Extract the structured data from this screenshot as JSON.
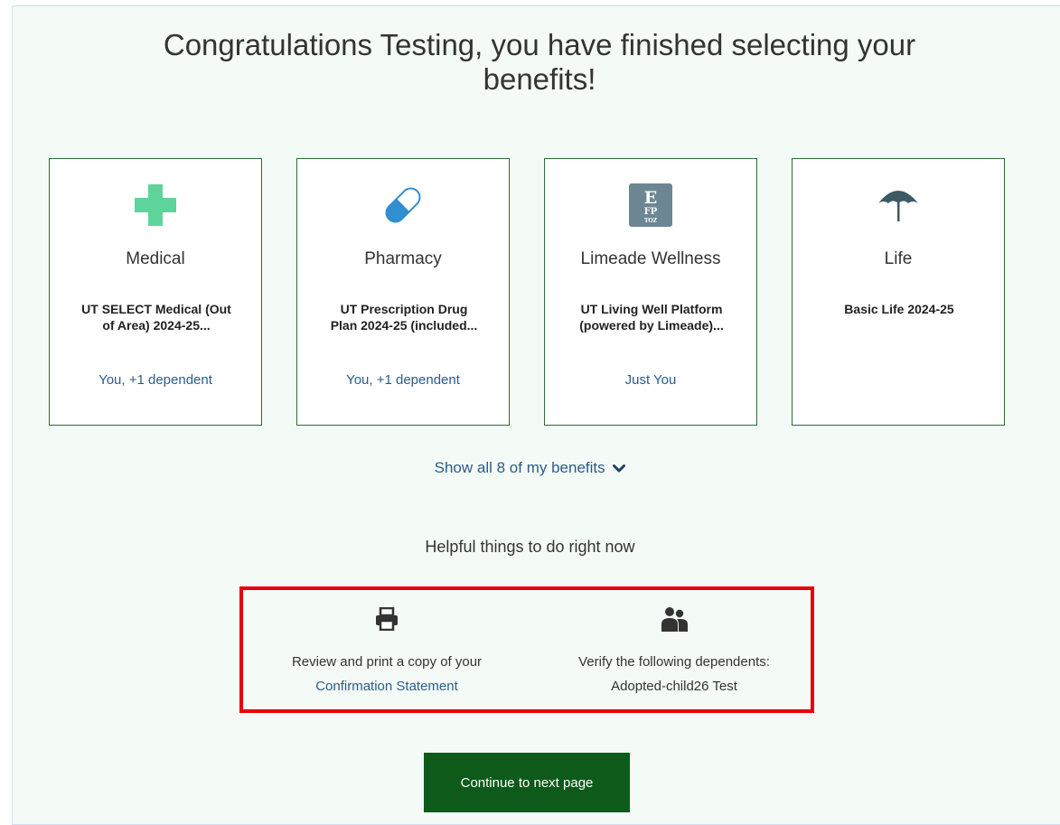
{
  "header": {
    "title_line1": "Congratulations Testing, you have finished selecting your",
    "title_line2": "benefits!"
  },
  "benefits": [
    {
      "icon": "medical-cross-icon",
      "name": "Medical",
      "plan_line1": "UT SELECT Medical (Out",
      "plan_line2": "of Area) 2024-25...",
      "coverage": "You, +1 dependent"
    },
    {
      "icon": "pill-capsule-icon",
      "name": "Pharmacy",
      "plan_line1": "UT Prescription Drug",
      "plan_line2": "Plan 2024-25 (included...",
      "coverage": "You, +1 dependent"
    },
    {
      "icon": "eye-chart-icon",
      "name": "Limeade Wellness",
      "plan_line1": "UT Living Well Platform",
      "plan_line2": "(powered by Limeade)...",
      "coverage": "Just You"
    },
    {
      "icon": "umbrella-icon",
      "name": "Life",
      "plan_line1": "Basic Life 2024-25",
      "plan_line2": "",
      "coverage": ""
    }
  ],
  "show_all": {
    "label": "Show all 8 of my benefits",
    "icon": "chevron-down-icon"
  },
  "helpful": {
    "heading": "Helpful things to do right now",
    "print": {
      "icon": "printer-icon",
      "text": "Review and print a copy of your",
      "link": "Confirmation Statement"
    },
    "dependents": {
      "icon": "people-icon",
      "text": "Verify the following dependents:",
      "name": "Adopted-child26 Test"
    }
  },
  "continue_label": "Continue to next page",
  "colors": {
    "accent_green": "#0e5a1a",
    "card_border": "#2e6a37",
    "link_blue": "#2b5c8a",
    "highlight_red": "#e8000b",
    "medical_icon": "#5fd49a",
    "pharmacy_icon": "#2f8fd0",
    "eye_chart_icon": "#6d8694",
    "umbrella_icon": "#3d5a63"
  }
}
